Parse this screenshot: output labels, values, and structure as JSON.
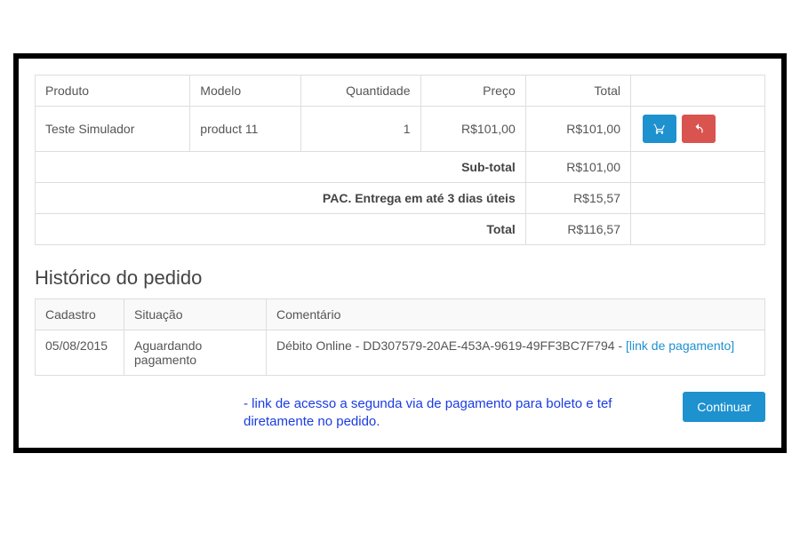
{
  "products_table": {
    "headers": {
      "produto": "Produto",
      "modelo": "Modelo",
      "quantidade": "Quantidade",
      "preco": "Preço",
      "total": "Total"
    },
    "row": {
      "produto": "Teste Simulador",
      "modelo": "product 11",
      "quantidade": "1",
      "preco": "R$101,00",
      "total": "R$101,00"
    },
    "subtotals": {
      "sub_total_label": "Sub-total",
      "sub_total_value": "R$101,00",
      "shipping_label": "PAC. Entrega em até 3 dias úteis",
      "shipping_value": "R$15,57",
      "total_label": "Total",
      "total_value": "R$116,57"
    }
  },
  "history": {
    "title": "Histórico do pedido",
    "headers": {
      "cadastro": "Cadastro",
      "situacao": "Situação",
      "comentario": "Comentário"
    },
    "row": {
      "cadastro": "05/08/2015",
      "situacao": "Aguardando pagamento",
      "comentario_text": "Débito Online - DD307579-20AE-453A-9619-49FF3BC7F794 - ",
      "comentario_link": "[link de pagamento]"
    }
  },
  "annotation": "- link de acesso a segunda via de pagamento para boleto e tef diretamente no pedido.",
  "continue_label": "Continuar"
}
